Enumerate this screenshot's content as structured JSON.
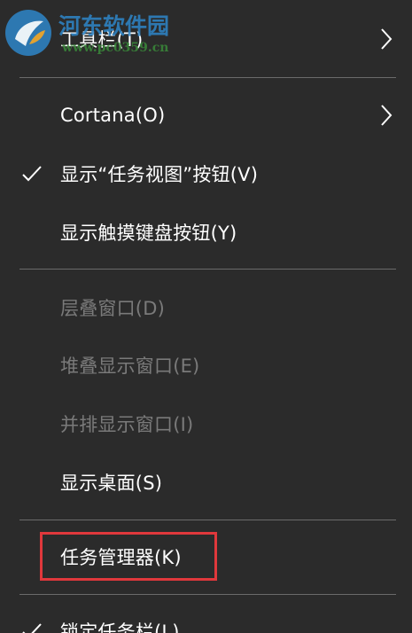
{
  "watermark": {
    "title": "河东软件园",
    "url": "www.pc0359.cn"
  },
  "colors": {
    "menu_background": "#2b2b2b",
    "text": "#ffffff",
    "disabled_text": "#7a7a7a",
    "divider": "#6b6b6b",
    "highlight_border": "#e0383c"
  },
  "menu": {
    "toolbars": {
      "label": "工具栏(T)",
      "icon": "chevron-right-icon"
    },
    "cortana": {
      "label": "Cortana(O)",
      "icon": "chevron-right-icon"
    },
    "show_task_view": {
      "label": "显示“任务视图”按钮(V)",
      "checked": true,
      "icon": "checkmark-icon"
    },
    "show_touch_keyboard": {
      "label": "显示触摸键盘按钮(Y)"
    },
    "cascade_windows": {
      "label": "层叠窗口(D)",
      "enabled": false
    },
    "stacked_windows": {
      "label": "堆叠显示窗口(E)",
      "enabled": false
    },
    "side_by_side": {
      "label": "并排显示窗口(I)",
      "enabled": false
    },
    "show_desktop": {
      "label": "显示桌面(S)"
    },
    "task_manager": {
      "label": "任务管理器(K)",
      "highlighted": true
    },
    "lock_taskbar": {
      "label": "锁定任务栏(L)",
      "checked": true,
      "icon": "checkmark-icon"
    }
  }
}
